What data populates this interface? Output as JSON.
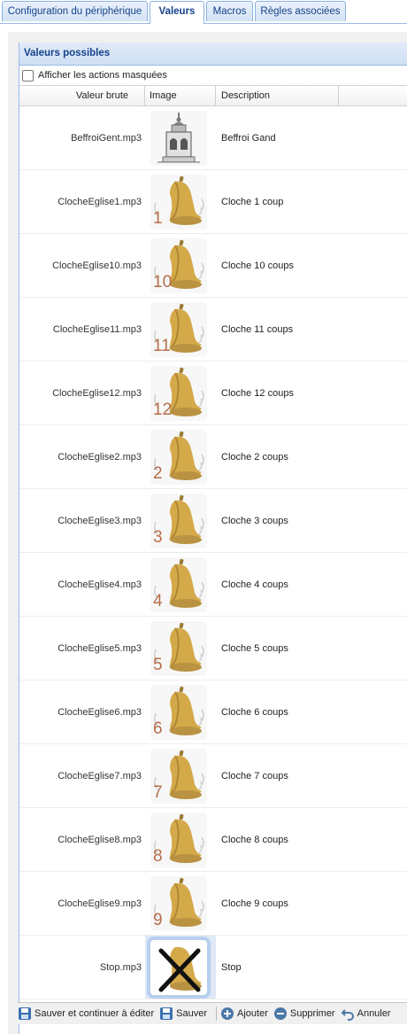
{
  "tabs": [
    {
      "label": "Configuration du périphérique"
    },
    {
      "label": "Valeurs"
    },
    {
      "label": "Macros"
    },
    {
      "label": "Règles associées"
    }
  ],
  "panel": {
    "title": "Valeurs possibles",
    "show_hidden_label": "Afficher les actions masquées",
    "columns": {
      "raw": "Valeur brute",
      "image": "Image",
      "desc": "Description"
    }
  },
  "rows": [
    {
      "raw": "BeffroiGent.mp3",
      "num": "",
      "desc": "Beffroi Gand",
      "icon": "belfry-icon"
    },
    {
      "raw": "ClocheEglise1.mp3",
      "num": "1",
      "desc": "Cloche 1 coup",
      "icon": "bell-icon"
    },
    {
      "raw": "ClocheEglise10.mp3",
      "num": "10",
      "desc": "Cloche 10 coups",
      "icon": "bell-icon"
    },
    {
      "raw": "ClocheEglise11.mp3",
      "num": "11",
      "desc": "Cloche 11 coups",
      "icon": "bell-icon"
    },
    {
      "raw": "ClocheEglise12.mp3",
      "num": "12",
      "desc": "Cloche 12 coups",
      "icon": "bell-icon"
    },
    {
      "raw": "ClocheEglise2.mp3",
      "num": "2",
      "desc": "Cloche 2 coups",
      "icon": "bell-icon"
    },
    {
      "raw": "ClocheEglise3.mp3",
      "num": "3",
      "desc": "Cloche 3 coups",
      "icon": "bell-icon"
    },
    {
      "raw": "ClocheEglise4.mp3",
      "num": "4",
      "desc": "Cloche 4 coups",
      "icon": "bell-icon"
    },
    {
      "raw": "ClocheEglise5.mp3",
      "num": "5",
      "desc": "Cloche 5 coups",
      "icon": "bell-icon"
    },
    {
      "raw": "ClocheEglise6.mp3",
      "num": "6",
      "desc": "Cloche 6 coups",
      "icon": "bell-icon"
    },
    {
      "raw": "ClocheEglise7.mp3",
      "num": "7",
      "desc": "Cloche 7 coups",
      "icon": "bell-icon"
    },
    {
      "raw": "ClocheEglise8.mp3",
      "num": "8",
      "desc": "Cloche 8 coups",
      "icon": "bell-icon"
    },
    {
      "raw": "ClocheEglise9.mp3",
      "num": "9",
      "desc": "Cloche 9 coups",
      "icon": "bell-icon"
    },
    {
      "raw": "Stop.mp3",
      "num": "",
      "desc": "Stop",
      "icon": "bell-crossed-icon",
      "selected": true
    }
  ],
  "toolbar": {
    "save_continue": "Sauver et continuer à éditer",
    "save": "Sauver",
    "add": "Ajouter",
    "delete": "Supprimer",
    "cancel": "Annuler"
  },
  "colors": {
    "accent": "#15428b",
    "border": "#99bbe8",
    "bell": "#d4a94a",
    "number": "#b76e4b"
  }
}
